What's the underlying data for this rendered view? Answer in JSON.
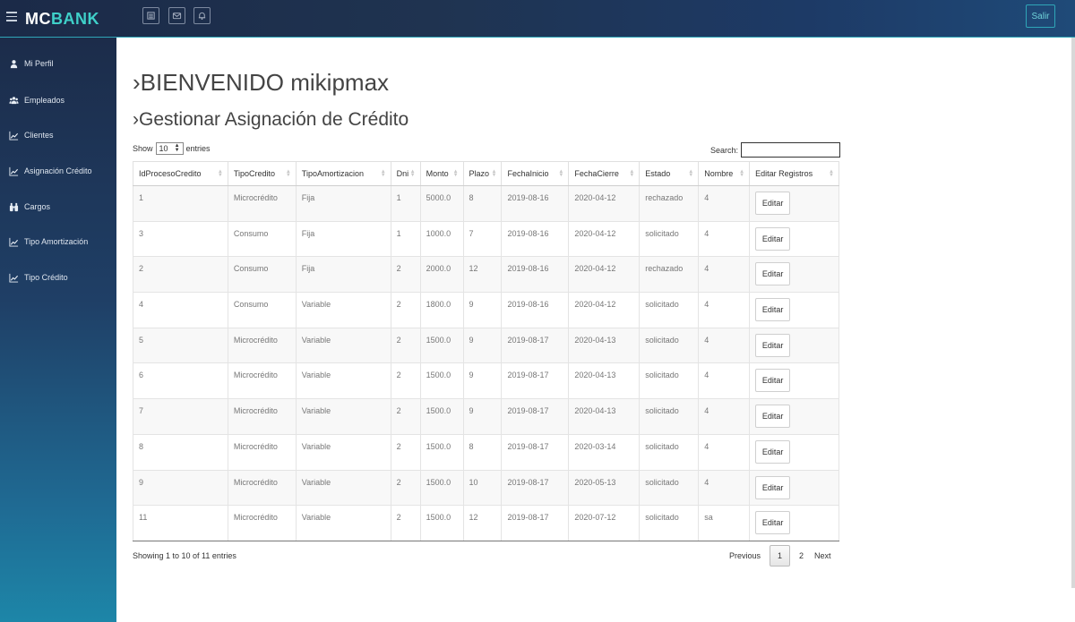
{
  "header": {
    "brand_mc": "MC",
    "brand_bank": "BANK",
    "logout_label": "Salir",
    "icons": [
      "list-icon",
      "mail-icon",
      "bell-icon"
    ]
  },
  "sidebar": {
    "items": [
      {
        "label": "Mi Perfil",
        "icon": "user-icon"
      },
      {
        "label": "Empleados",
        "icon": "users-icon"
      },
      {
        "label": "Clientes",
        "icon": "chart-icon"
      },
      {
        "label": "Asignación Crédito",
        "icon": "chart-icon"
      },
      {
        "label": "Cargos",
        "icon": "binoculars-icon"
      },
      {
        "label": "Tipo Amortización",
        "icon": "chart-icon"
      },
      {
        "label": "Tipo Crédito",
        "icon": "chart-icon"
      }
    ]
  },
  "main": {
    "welcome": "›BIENVENIDO mikipmax",
    "subtitle": "›Gestionar Asignación de Crédito",
    "show_label": "Show",
    "entries_value": "10",
    "entries_label": "entries",
    "search_label": "Search:",
    "columns": [
      "IdProcesoCredito",
      "TipoCredito",
      "TipoAmortizacion",
      "Dni",
      "Monto",
      "Plazo",
      "FechaInicio",
      "FechaCierre",
      "Estado",
      "Nombre",
      "Editar Registros"
    ],
    "rows": [
      [
        "1",
        "Microcrédito",
        "Fija",
        "1",
        "5000.0",
        "8",
        "2019-08-16",
        "2020-04-12",
        "rechazado",
        "4"
      ],
      [
        "3",
        "Consumo",
        "Fija",
        "1",
        "1000.0",
        "7",
        "2019-08-16",
        "2020-04-12",
        "solicitado",
        "4"
      ],
      [
        "2",
        "Consumo",
        "Fija",
        "2",
        "2000.0",
        "12",
        "2019-08-16",
        "2020-04-12",
        "rechazado",
        "4"
      ],
      [
        "4",
        "Consumo",
        "Variable",
        "2",
        "1800.0",
        "9",
        "2019-08-16",
        "2020-04-12",
        "solicitado",
        "4"
      ],
      [
        "5",
        "Microcrédito",
        "Variable",
        "2",
        "1500.0",
        "9",
        "2019-08-17",
        "2020-04-13",
        "solicitado",
        "4"
      ],
      [
        "6",
        "Microcrédito",
        "Variable",
        "2",
        "1500.0",
        "9",
        "2019-08-17",
        "2020-04-13",
        "solicitado",
        "4"
      ],
      [
        "7",
        "Microcrédito",
        "Variable",
        "2",
        "1500.0",
        "9",
        "2019-08-17",
        "2020-04-13",
        "solicitado",
        "4"
      ],
      [
        "8",
        "Microcrédito",
        "Variable",
        "2",
        "1500.0",
        "8",
        "2019-08-17",
        "2020-03-14",
        "solicitado",
        "4"
      ],
      [
        "9",
        "Microcrédito",
        "Variable",
        "2",
        "1500.0",
        "10",
        "2019-08-17",
        "2020-05-13",
        "solicitado",
        "4"
      ],
      [
        "11",
        "Microcrédito",
        "Variable",
        "2",
        "1500.0",
        "12",
        "2019-08-17",
        "2020-07-12",
        "solicitado",
        "sa"
      ]
    ],
    "edit_label": "Editar",
    "info": "Showing 1 to 10 of 11 entries",
    "pagination": {
      "previous": "Previous",
      "pages": [
        "1",
        "2"
      ],
      "next": "Next",
      "current": "1"
    }
  }
}
